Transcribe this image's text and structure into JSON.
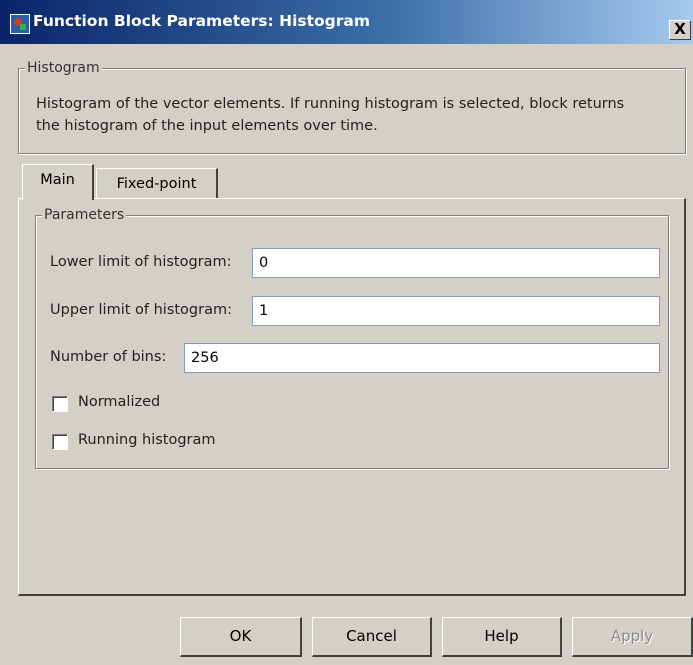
{
  "window": {
    "title": "Function Block Parameters: Histogram",
    "close_label": "X"
  },
  "description_group": {
    "legend": "Histogram",
    "text_line1": "Histogram of the vector elements.  If running histogram is selected, block returns",
    "text_line2": "the histogram of the input elements over time."
  },
  "tabs": [
    {
      "label": "Main",
      "selected": true
    },
    {
      "label": "Fixed-point",
      "selected": false
    }
  ],
  "parameters": {
    "legend": "Parameters",
    "lower_limit": {
      "label": "Lower limit of histogram:",
      "value": "0"
    },
    "upper_limit": {
      "label": "Upper limit of histogram:",
      "value": "1"
    },
    "num_bins": {
      "label": "Number of bins:",
      "value": "256"
    },
    "normalized": {
      "label": "Normalized",
      "checked": false
    },
    "running": {
      "label": "Running histogram",
      "checked": false
    }
  },
  "buttons": {
    "ok": "OK",
    "cancel": "Cancel",
    "help": "Help",
    "apply": "Apply"
  }
}
